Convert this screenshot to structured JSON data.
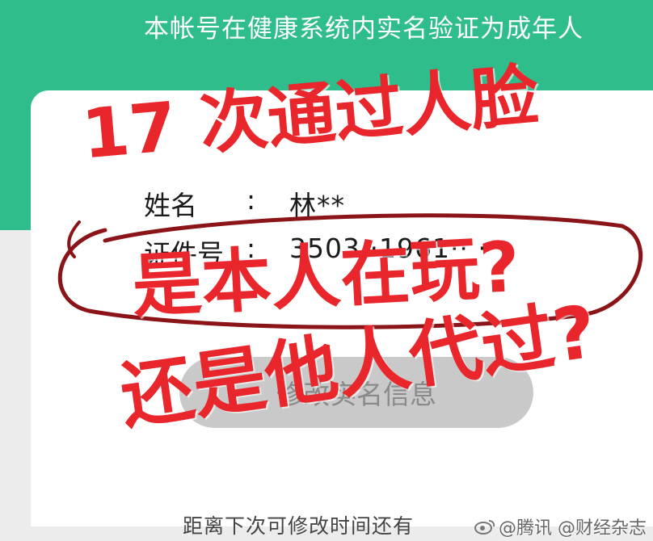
{
  "header": {
    "notice": "本帐号在健康系统内实名验证为成年人"
  },
  "info": {
    "name_label": "姓名",
    "colon": ":",
    "name_value": "林**",
    "id_label": "证件号",
    "id_colon": ":",
    "id_value": "3503··1961·· ····"
  },
  "button": {
    "label": "修改实名信息"
  },
  "footer": {
    "text": "距离下次可修改时间还有"
  },
  "overlay": {
    "line1": "17 次通过人脸",
    "line2": "是本人在玩?",
    "line3": "还是他人代过?"
  },
  "watermark": {
    "text": "@腾讯 @财经杂志"
  },
  "colors": {
    "header_green": "#2fbd8c",
    "overlay_red": "#e8262b",
    "button_grey": "#c9c9c9"
  }
}
